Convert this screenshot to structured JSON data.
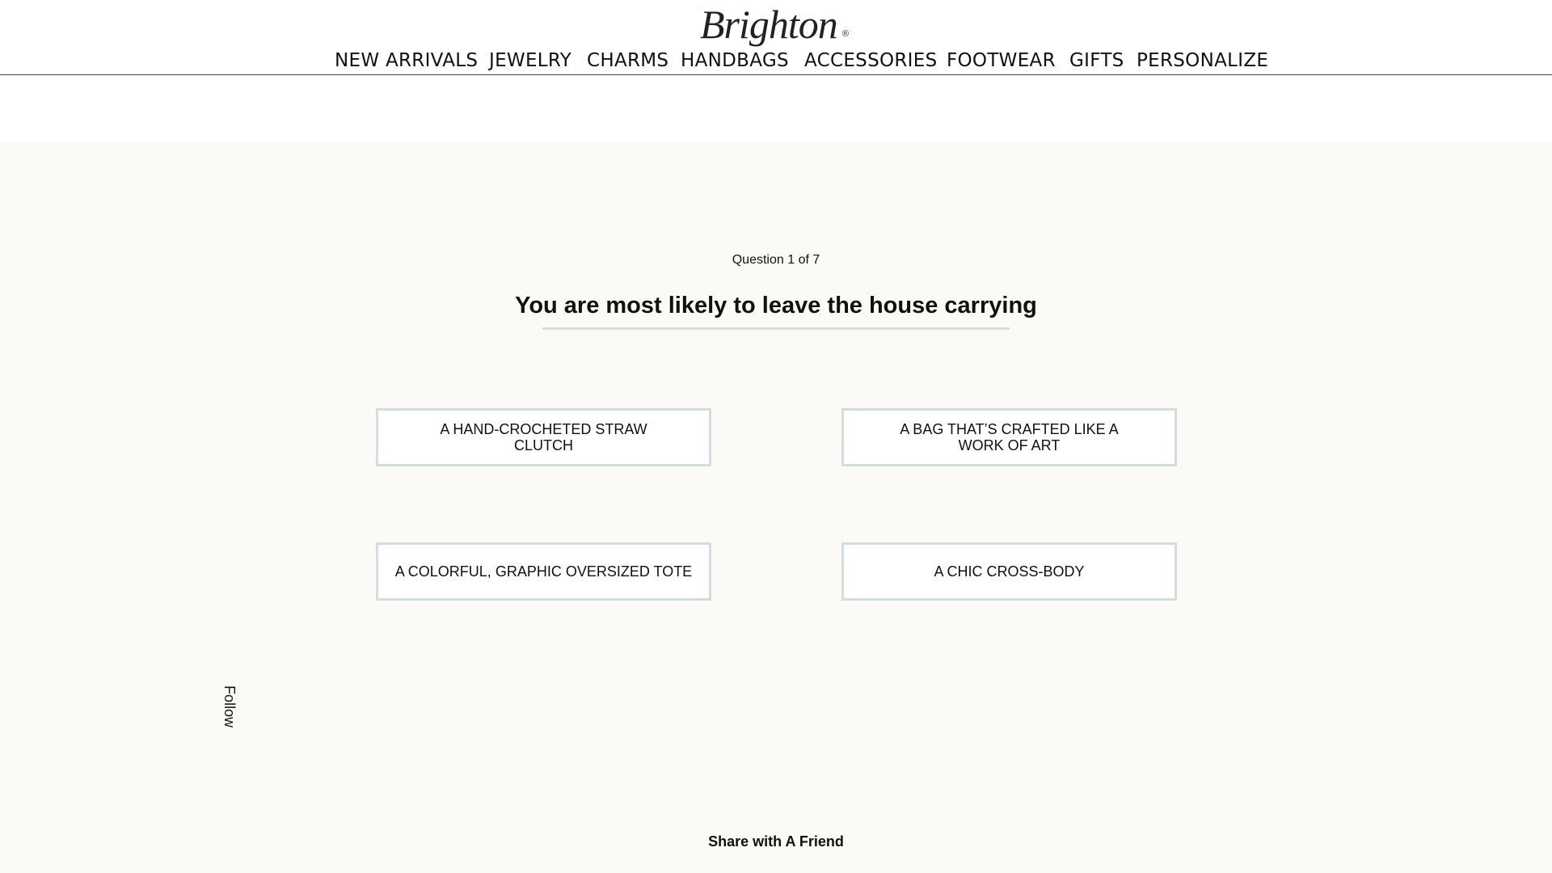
{
  "brand": {
    "name": "Brighton",
    "mark": "®"
  },
  "nav": [
    "NEW ARRIVALS",
    "JEWELRY",
    "CHARMS",
    "HANDBAGS",
    "ACCESSORIES",
    "FOOTWEAR",
    "GIFTS",
    "PERSONALIZE"
  ],
  "quiz": {
    "counter": "Question 1 of 7",
    "question": "You are most likely to leave the house carrying",
    "options": [
      "A HAND-CROCHETED STRAW CLUTCH",
      "A BAG THAT’S CRAFTED LIKE A WORK OF ART",
      "A COLORFUL, GRAPHIC OVERSIZED TOTE",
      "A CHIC CROSS-BODY"
    ]
  },
  "follow_label": "Follow",
  "share_label": "Share with A Friend",
  "colors": {
    "page_bg": "#fbfaf6",
    "option_border": "#d4dddd",
    "text": "#111111"
  }
}
